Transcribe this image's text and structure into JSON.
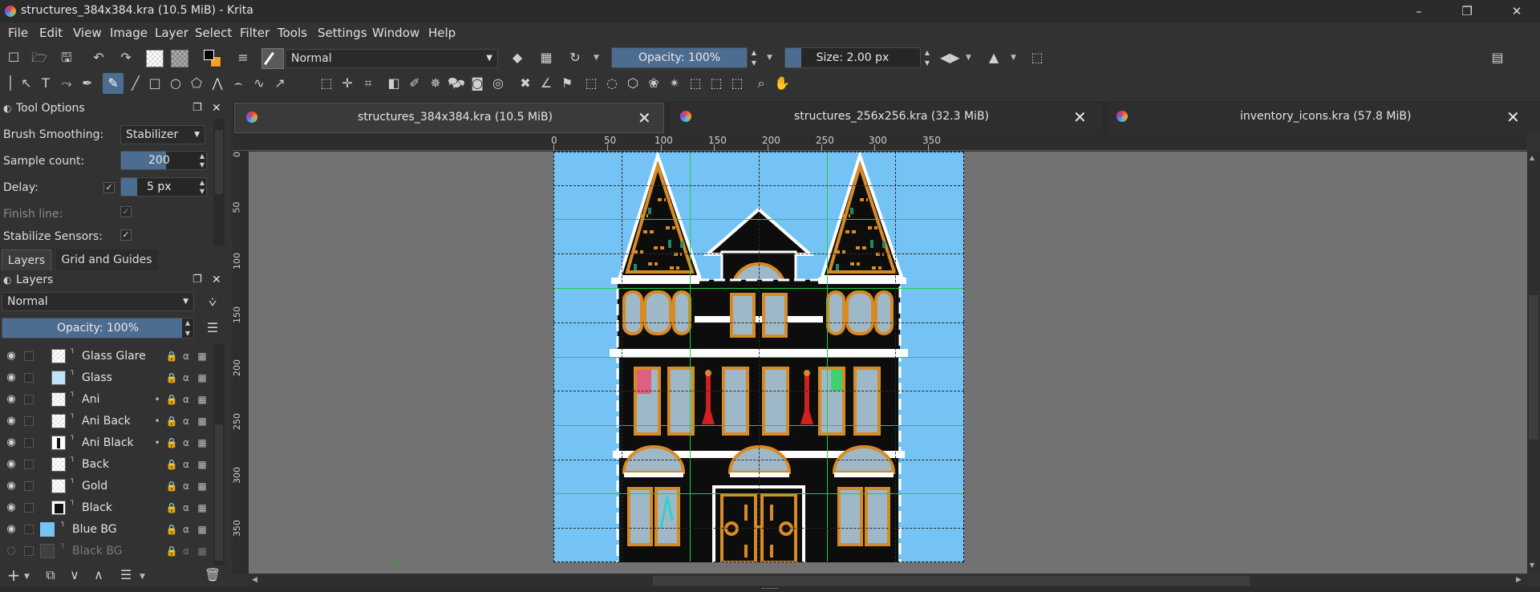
{
  "window": {
    "title": "structures_384x384.kra (10.5 MiB)  - Krita"
  },
  "menu": [
    "File",
    "Edit",
    "View",
    "Image",
    "Layer",
    "Select",
    "Filter",
    "Tools",
    "Settings",
    "Window",
    "Help"
  ],
  "toolbar": {
    "blend_mode": "Normal",
    "opacity_label": "Opacity: 100%",
    "opacity_value": 1.0,
    "size_label": "Size: 2.00 px"
  },
  "tool_options": {
    "title": "Tool Options",
    "brush_smoothing_label": "Brush Smoothing:",
    "brush_smoothing_value": "Stabilizer",
    "sample_count_label": "Sample count:",
    "sample_count_value": "200",
    "delay_label": "Delay:",
    "delay_value": "5 px",
    "finish_line_label": "Finish line:",
    "stabilize_sensors_label": "Stabilize Sensors:"
  },
  "panel_tabs": [
    "Layers",
    "Grid and Guides"
  ],
  "layers_panel": {
    "title": "Layers",
    "blend_mode": "Normal",
    "opacity_label": "Opacity:  100%",
    "layers": [
      {
        "name": "Glass Glare"
      },
      {
        "name": "Glass"
      },
      {
        "name": "Ani"
      },
      {
        "name": "Ani Back"
      },
      {
        "name": "Ani Black"
      },
      {
        "name": "Back"
      },
      {
        "name": "Gold"
      },
      {
        "name": "Black"
      },
      {
        "name": "Blue BG"
      },
      {
        "name": "Black BG"
      }
    ]
  },
  "doc_tabs": [
    {
      "label": "structures_384x384.kra (10.5 MiB)"
    },
    {
      "label": "structures_256x256.kra (32.3 MiB)"
    },
    {
      "label": "inventory_icons.kra (57.8 MiB)"
    }
  ],
  "ruler": {
    "h_ticks": [
      "0",
      "50",
      "100",
      "150",
      "200",
      "250",
      "300",
      "350"
    ],
    "v_ticks": [
      "0",
      "50",
      "100",
      "150",
      "200",
      "250",
      "300",
      "350"
    ]
  },
  "colors": {
    "accent": "#4d6d90",
    "canvas_bg": "#75c3f5",
    "grid": "#22cc44",
    "building": "#0d0d0d",
    "gold": "#d88a24"
  }
}
